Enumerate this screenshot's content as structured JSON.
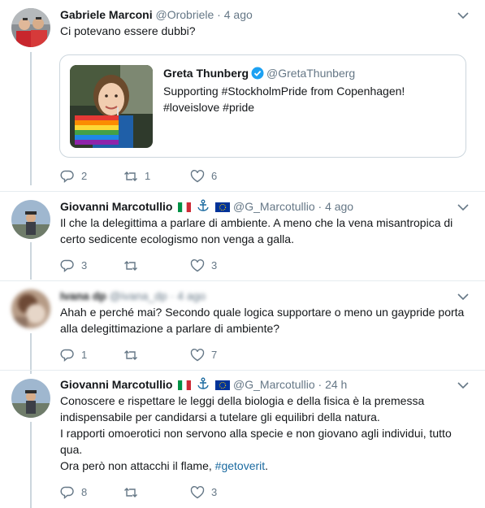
{
  "tweets": [
    {
      "name": "Gabriele Marconi",
      "handle": "@Orobriele",
      "time": "4 ago",
      "text": "Ci potevano essere dubbi?",
      "quote": {
        "name": "Greta Thunberg",
        "handle": "@GretaThunberg",
        "line1": "Supporting #StockholmPride from Copenhagen!",
        "line2": "#loveislove #pride"
      },
      "reply_count": "2",
      "retweet_count": "1",
      "like_count": "6"
    },
    {
      "name": "Giovanni Marcotullio",
      "handle": "@G_Marcotullio",
      "time": "4 ago",
      "text": "Il che la delegittima a parlare di ambiente. A meno che la vena misantropica di certo sedicente ecologismo non venga a galla.",
      "reply_count": "3",
      "retweet_count": "",
      "like_count": "3"
    },
    {
      "name": "Ivana dp",
      "handle": "@ivana_dp",
      "time": "4 ago",
      "text": "Ahah e perché mai? Secondo quale logica supportare o meno un gaypride porta alla delegittimazione a parlare di ambiente?",
      "reply_count": "1",
      "retweet_count": "",
      "like_count": "7"
    },
    {
      "name": "Giovanni Marcotullio",
      "handle": "@G_Marcotullio",
      "time": "24 h",
      "text_lines": [
        "Conoscere e rispettare le leggi della biologia e della fisica è la premessa indispensabile per candidarsi a tutelare gli equilibri della natura.",
        "I rapporti omoerotici non servono alla specie e non giovano agli individui, tutto qua.",
        "Ora però non attacchi il flame, "
      ],
      "hashtag": "#getoverit",
      "hashtag_suffix": ".",
      "reply_count": "8",
      "retweet_count": "",
      "like_count": "3"
    }
  ],
  "dot": "·",
  "icons": [
    "reply-icon",
    "retweet-icon",
    "like-icon",
    "caret-down-icon",
    "verified-badge-icon",
    "flag-italy-icon",
    "anchor-icon",
    "flag-eu-icon"
  ],
  "colors": {
    "text": "#14171a",
    "muted": "#657786",
    "link": "#1b6aa0",
    "verified": "#1da1f2",
    "border": "#e6ecf0",
    "line": "#ccd6dd"
  }
}
